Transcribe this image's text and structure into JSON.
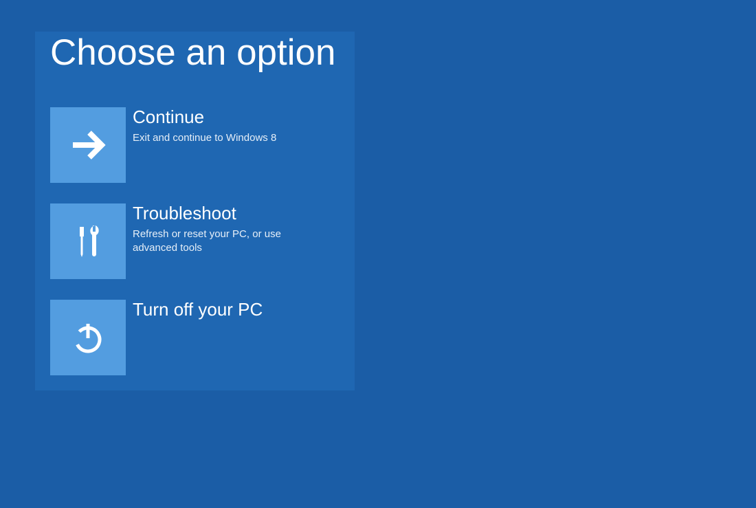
{
  "page_title": "Choose an option",
  "options": [
    {
      "title": "Continue",
      "description": "Exit and continue to Windows 8"
    },
    {
      "title": "Troubleshoot",
      "description": "Refresh or reset your PC, or use advanced tools"
    },
    {
      "title": "Turn off your PC",
      "description": ""
    }
  ]
}
